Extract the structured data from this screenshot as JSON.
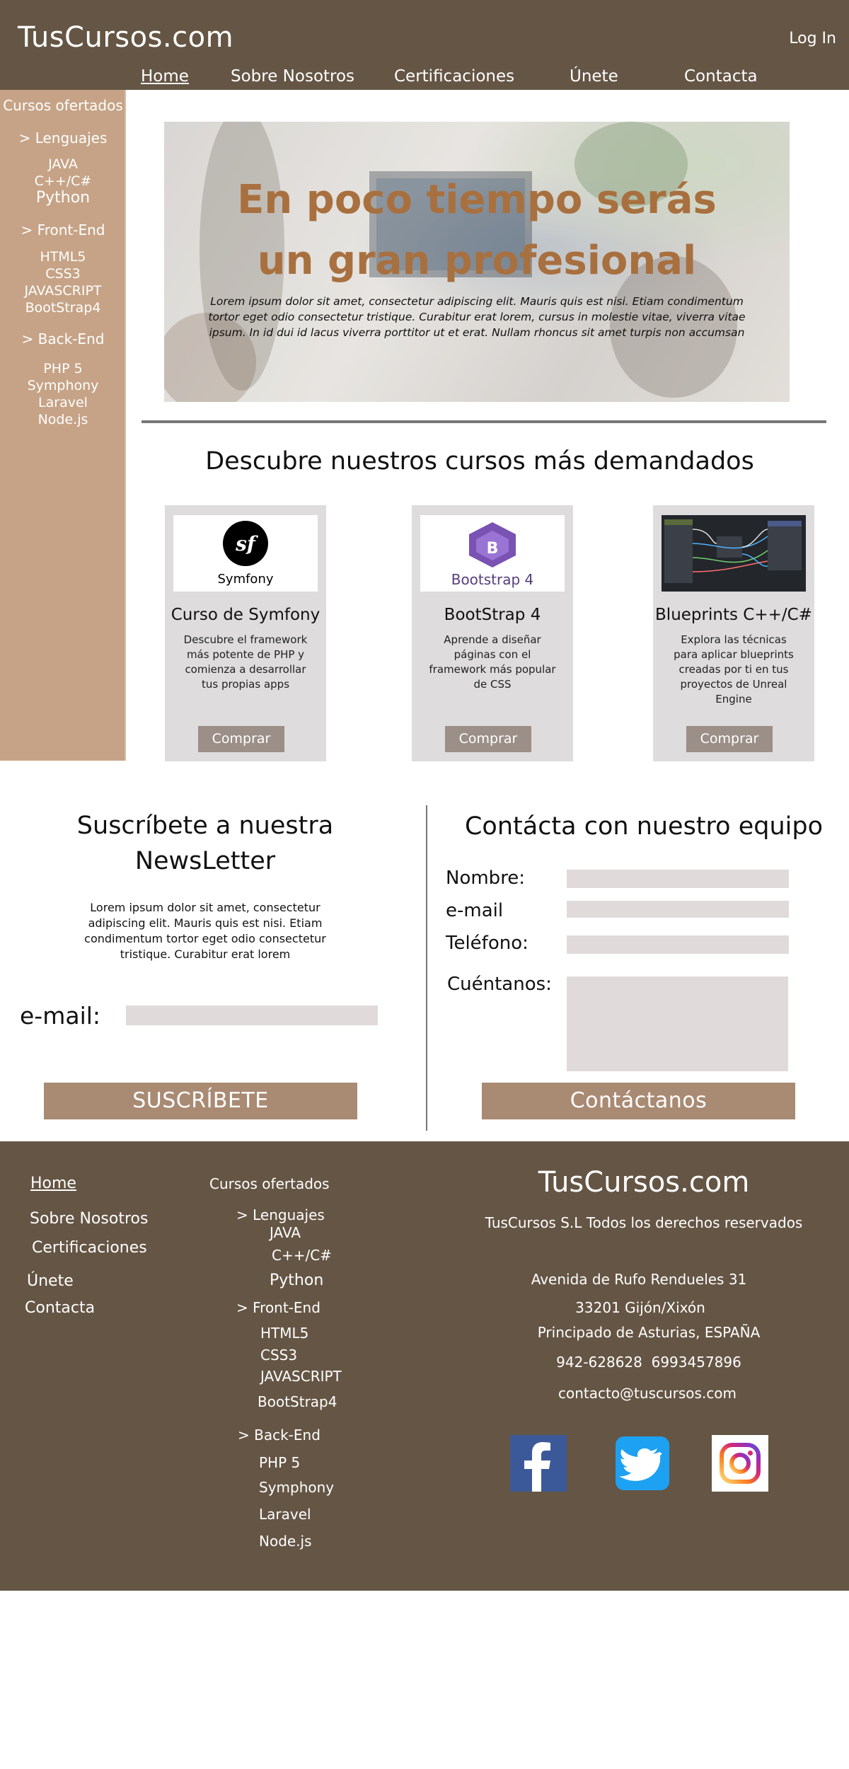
{
  "header": {
    "logo": "TusCursos.com",
    "login": "Log In",
    "nav": [
      "Home",
      "Sobre Nosotros",
      "Certificaciones",
      "Únete",
      "Contacta"
    ]
  },
  "sidebar": {
    "title": "Cursos ofertados",
    "groups": [
      {
        "label": "> Lenguajes",
        "items": [
          "JAVA",
          "C++/C#",
          "Python"
        ]
      },
      {
        "label": ">  Front-End",
        "items": [
          "HTML5",
          "CSS3",
          "JAVASCRIPT",
          "BootStrap4"
        ]
      },
      {
        "label": "> Back-End",
        "items": [
          "PHP 5",
          "Symphony",
          "Laravel",
          "Node.js"
        ]
      }
    ]
  },
  "hero": {
    "title_line1": "En poco tiempo serás",
    "title_line2": "un gran profesional",
    "text": "Lorem ipsum dolor sit amet, consectetur adipiscing elit. Mauris quis est nisi. Etiam condimentum tortor eget odio consectetur tristique. Curabitur erat lorem, cursus in molestie vitae, viverra vitae ipsum. In id dui id lacus viverra porttitor ut et erat. Nullam rhoncus sit amet turpis non accumsan"
  },
  "courses": {
    "title": "Descubre nuestros cursos más demandados",
    "buy_label": "Comprar",
    "items": [
      {
        "title": "Curso de Symfony",
        "desc": "Descubre el framework más potente de PHP y comienza a desarrollar tus propias apps",
        "logo_text": "Symfony",
        "logo_mark": "sf"
      },
      {
        "title": "BootStrap 4",
        "desc": "Aprende a diseñar páginas con el framework más popular de CSS",
        "logo_text": "Bootstrap 4",
        "logo_mark": "B"
      },
      {
        "title": "Blueprints C++/C#",
        "desc": "Explora las técnicas para aplicar blueprints creadas por ti en tus proyectos de Unreal Engine"
      }
    ]
  },
  "newsletter": {
    "title": "Suscríbete a nuestra NewsLetter",
    "text": "Lorem ipsum dolor sit amet, consectetur adipiscing elit. Mauris quis est nisi. Etiam condimentum tortor eget odio consectetur tristique. Curabitur erat lorem",
    "email_label": "e-mail:",
    "email_value": "",
    "button": "SUSCRÍBETE"
  },
  "contact": {
    "title": "Contácta con nuestro equipo",
    "fields": [
      "Nombre:",
      "e-mail",
      "Teléfono:",
      "Cuéntanos:"
    ],
    "button": "Contáctanos"
  },
  "footer": {
    "links": [
      "Home",
      "Sobre Nosotros",
      "Certificaciones",
      "Únete",
      "Contacta"
    ],
    "courses_title": "Cursos ofertados",
    "col2": {
      "g1": "> Lenguajes",
      "g1_items": [
        "JAVA",
        "C++/C#",
        "Python"
      ],
      "g2": ">  Front-End",
      "g2_items": [
        "HTML5",
        "CSS3",
        "JAVASCRIPT",
        "BootStrap4"
      ],
      "g3": "> Back-End",
      "g3_items": [
        "PHP 5",
        "Symphony",
        "Laravel",
        "Node.js"
      ]
    },
    "brand": "TusCursos.com",
    "rights": "TusCursos S.L Todos los derechos reservados",
    "address1": "Avenida de Rufo Rendueles 31",
    "address2": "33201 Gijón/Xixón",
    "address3": "Principado de Asturias, ESPAÑA",
    "phones": "942-628628  6993457896",
    "email": "contacto@tuscursos.com",
    "social": [
      "facebook-icon",
      "twitter-icon",
      "instagram-icon"
    ]
  },
  "colors": {
    "header_bg": "#655544",
    "sidebar_bg": "#c6a386",
    "hero_title": "#a8703f",
    "card_bg": "#dedcdc",
    "button_gray": "#9b8f88",
    "button_brown": "#a98a73",
    "input_bg": "#e0dbda"
  }
}
